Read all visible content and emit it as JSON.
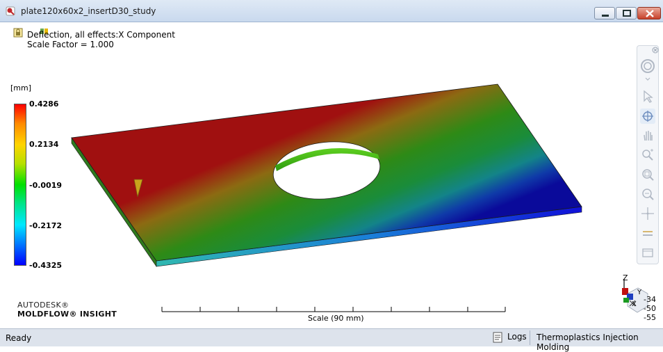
{
  "window": {
    "title": "plate120x60x2_insertD30_study"
  },
  "result": {
    "title": "Deflection, all effects:X Component",
    "scale_factor": "Scale Factor = 1.000",
    "unit": "[mm]",
    "legend_ticks": [
      "0.4286",
      "0.2134",
      "-0.0019",
      "-0.2172",
      "-0.4325"
    ]
  },
  "scale": {
    "label": "Scale (90 mm)"
  },
  "branding": {
    "line1": "AUTODESK®",
    "line2": "MOLDFLOW® INSIGHT"
  },
  "triad": {
    "axis_z": "Z",
    "axis_y": "Y",
    "axis_x": "X",
    "angles": [
      "-34",
      "-50",
      "-55"
    ]
  },
  "status": {
    "ready": "Ready",
    "logs": "Logs",
    "module": "Thermoplastics Injection Molding"
  },
  "toolbar": {
    "icons": [
      "orbit-icon",
      "select-icon",
      "rotate-icon",
      "pan-icon",
      "zoom-icon",
      "zoom-window-icon",
      "zoom-fit-icon",
      "center-icon",
      "section-icon",
      "measure-icon"
    ]
  },
  "colors": {
    "max": "#ff0000",
    "mid": "#00e000",
    "min": "#0000ff",
    "titlebar": "#c9d9ee"
  }
}
